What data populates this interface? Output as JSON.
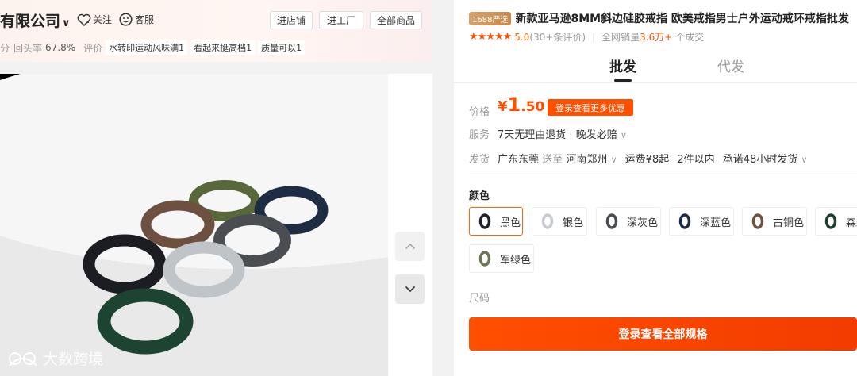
{
  "shop": {
    "name": "有限公司",
    "chevron": "∨",
    "follow_label": "关注",
    "service_label": "客服",
    "buttons": [
      "进店铺",
      "进工厂",
      "全部商品"
    ],
    "stats": {
      "partial_prefix": "分",
      "return_label": "回头率",
      "return_value": "67.8%",
      "review_label": "评价",
      "tags": [
        "水转印运动风味满1",
        "看起来挺高档1",
        "质量可以1"
      ]
    }
  },
  "gallery": {
    "watermark": "大数跨境",
    "up_icon": "chevron-up-icon",
    "down_icon": "chevron-down-icon"
  },
  "product": {
    "badge": "1688严选",
    "title": "新款亚马逊8MM斜边硅胶戒指 欧美戒指男士户外运动戒环戒指批发",
    "stars": "★★★★★",
    "rating": "5.0",
    "review_count": "(30+条评价)",
    "sales_label": "全网销量",
    "sales_value": "3.6万+",
    "sales_suffix": "个成交",
    "tabs": [
      "批发",
      "代发"
    ],
    "active_tab": 0
  },
  "price": {
    "label": "价格",
    "currency": "¥",
    "int": "1",
    "dec": ".50",
    "promo": "登录查看更多优惠"
  },
  "service": {
    "label": "服务",
    "text": "7天无理由退货",
    "dot": "·",
    "extra": "晚发必赔"
  },
  "shipping": {
    "label": "发货",
    "from": "广东东莞",
    "to_word": "送至",
    "to": "河南郑州",
    "fee": "运费¥8起",
    "qty": "2件以内",
    "promise": "承诺48小时发货"
  },
  "colors": {
    "label": "颜色",
    "options": [
      {
        "name": "黑色",
        "color": "#1f2227",
        "selected": true
      },
      {
        "name": "银色",
        "color": "#c8ccd0",
        "selected": false
      },
      {
        "name": "深灰色",
        "color": "#4a4d52",
        "selected": false
      },
      {
        "name": "深蓝色",
        "color": "#1c2a44",
        "selected": false
      },
      {
        "name": "古铜色",
        "color": "#6e5240",
        "selected": false
      },
      {
        "name": "森绿",
        "color": "#1d3f2c",
        "selected": false
      },
      {
        "name": "军绿色",
        "color": "#6b7753",
        "selected": false
      }
    ]
  },
  "size": {
    "label": "尺码"
  },
  "cta": {
    "label": "登录查看全部规格"
  },
  "accent": "#ff5000"
}
